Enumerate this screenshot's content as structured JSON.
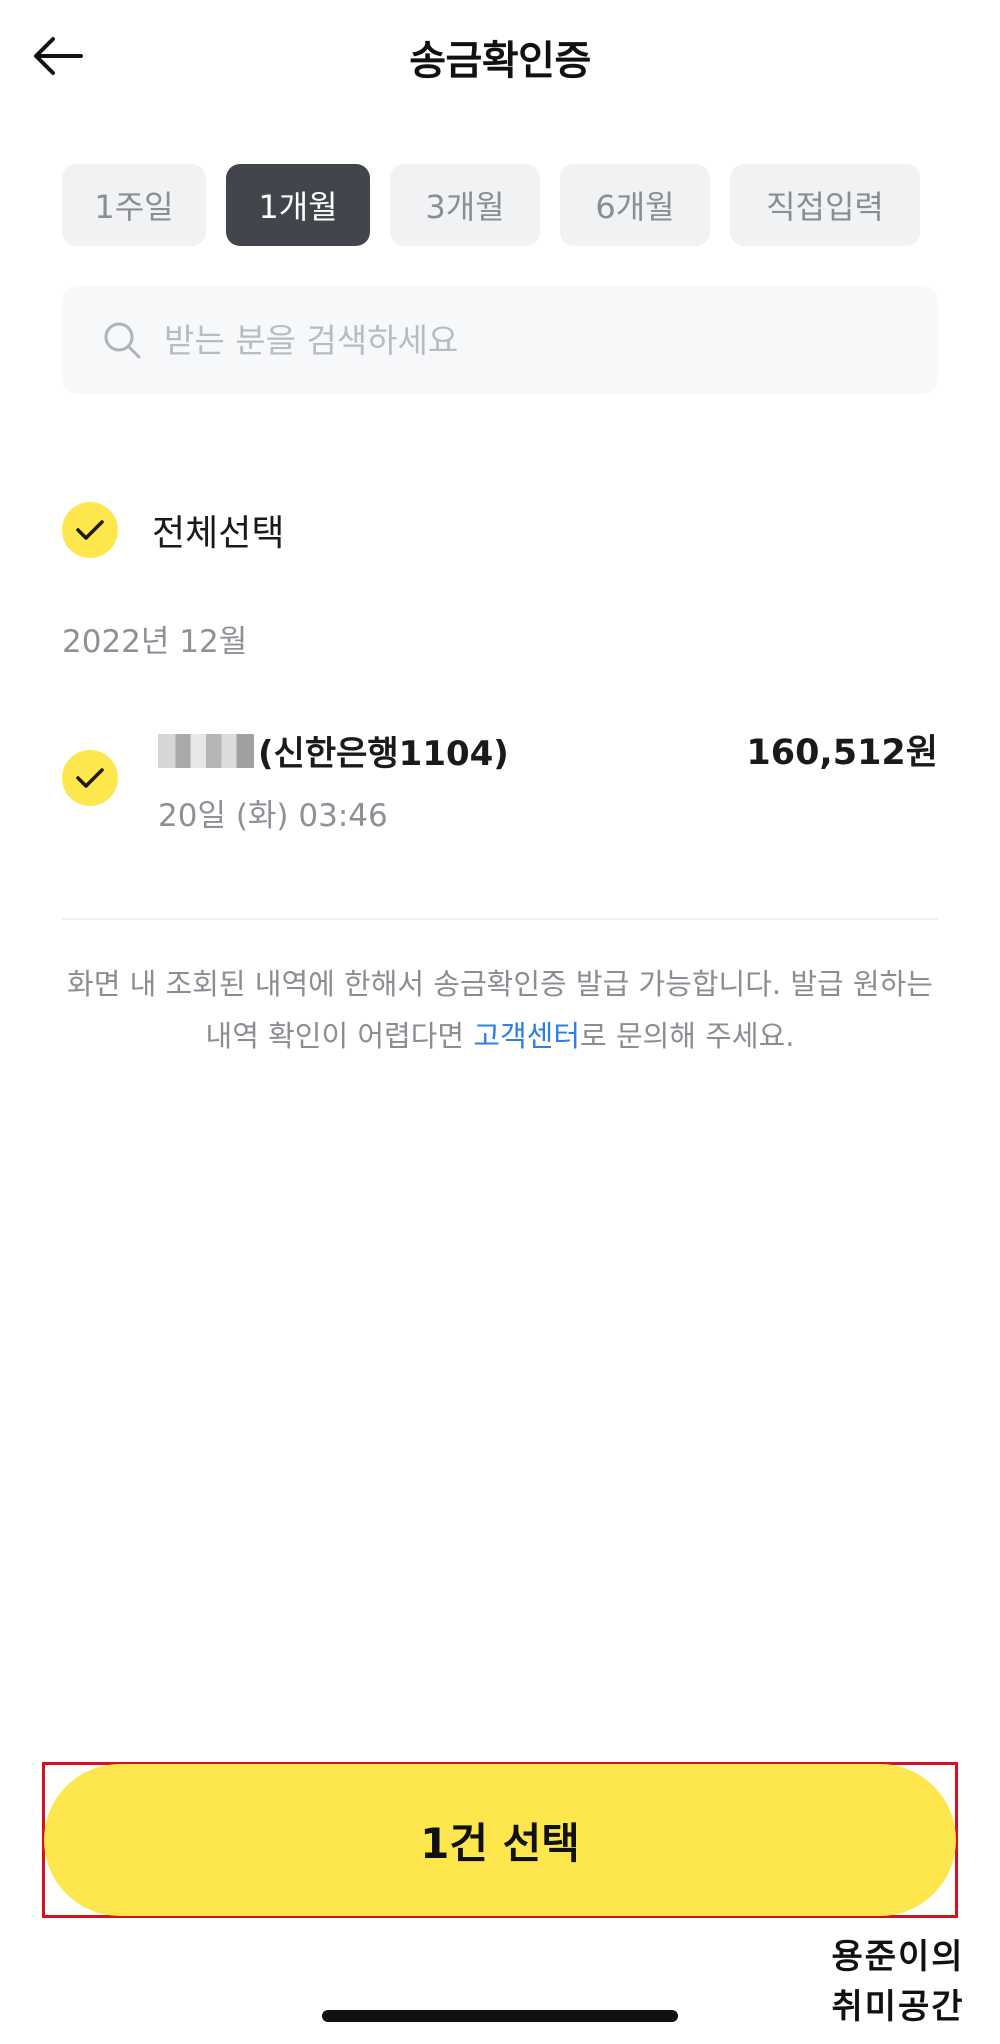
{
  "header": {
    "title": "송금확인증",
    "back_icon": "arrow-left-icon"
  },
  "period_tabs": [
    {
      "label": "1주일",
      "active": false
    },
    {
      "label": "1개월",
      "active": true
    },
    {
      "label": "3개월",
      "active": false
    },
    {
      "label": "6개월",
      "active": false
    },
    {
      "label": "직접입력",
      "active": false
    }
  ],
  "search": {
    "placeholder": "받는 분을 검색하세요",
    "value": "",
    "icon": "search-icon"
  },
  "select_all": {
    "label": "전체선택",
    "checked": true
  },
  "month_group": {
    "label": "2022년 12월"
  },
  "transactions": [
    {
      "bank": "(신한은행1104)",
      "datetime": "20일 (화) 03:46",
      "amount": "160,512원",
      "checked": true
    }
  ],
  "notice": {
    "text_before": "화면 내 조회된 내역에 한해서 송금확인증 발급 가능합니다. 발급 원하는 내역 확인이 어렵다면 ",
    "link_text": "고객센터",
    "text_after": "로 문의해 주세요."
  },
  "action": {
    "button_label": "1건 선택"
  },
  "watermark": {
    "line1": "용준이의",
    "line2": "취미공간"
  },
  "colors": {
    "accent_yellow": "#fde74c",
    "active_tab": "#42464c",
    "link_blue": "#2f7fe0",
    "highlight_red": "#d7101c"
  }
}
